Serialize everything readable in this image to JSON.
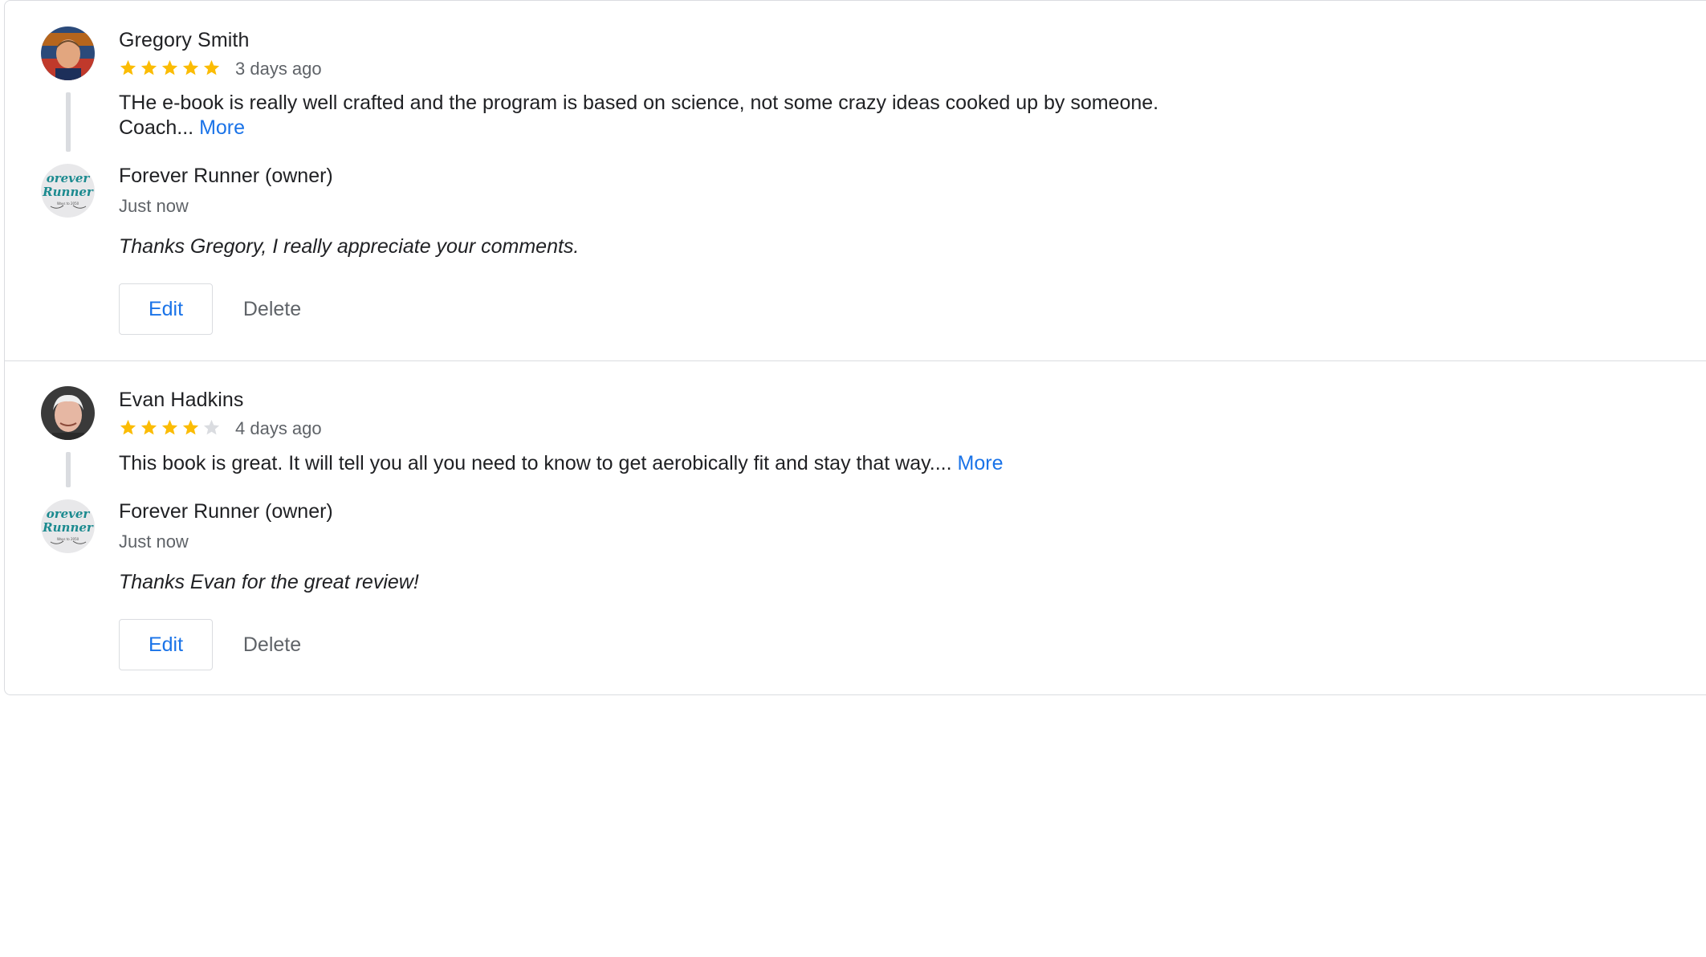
{
  "reviews": [
    {
      "reviewer": "Gregory Smith",
      "rating": 5,
      "max_rating": 5,
      "date": "3 days ago",
      "text_line1": "THe e-book is really well crafted and the program is based on science, not some crazy ideas cooked up by someone.",
      "text_line2": "Coach...",
      "more_label": "More",
      "reply": {
        "owner": "Forever Runner (owner)",
        "date": "Just now",
        "text": "Thanks Gregory, I really appreciate your comments."
      },
      "edit_label": "Edit",
      "delete_label": "Delete"
    },
    {
      "reviewer": "Evan Hadkins",
      "rating": 4,
      "max_rating": 5,
      "date": "4 days ago",
      "text_line1": "This book is great. It will tell you all you need to know to get aerobically fit and stay that way....",
      "more_label": "More",
      "reply": {
        "owner": "Forever Runner (owner)",
        "date": "Just now",
        "text": "Thanks Evan for the great review!"
      },
      "edit_label": "Edit",
      "delete_label": "Delete"
    }
  ],
  "owner_logo": {
    "line1": "orever",
    "line2": "Runner",
    "tagline": "Ways to 2050"
  },
  "colors": {
    "star_filled": "#fbbc04",
    "star_empty": "#dadce0",
    "link": "#1a73e8",
    "divider": "#dadce0",
    "logo_text": "#1b8a8f"
  }
}
